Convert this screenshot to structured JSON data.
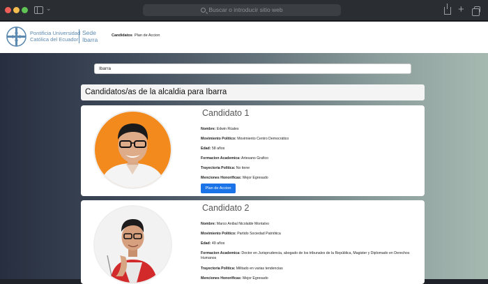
{
  "browser": {
    "url_placeholder": "Buscar o introducir sitio web"
  },
  "header": {
    "logo_line1": "Pontificia Universidad",
    "logo_line2": "Católica del Ecuador",
    "sede_line1": "Sede",
    "sede_line2": "Ibarra",
    "nav": [
      "Candidatos",
      "Plan de Accion"
    ]
  },
  "search": {
    "value": "Ibarra"
  },
  "section_title": "Candidatos/as de la alcaldia para Ibarra",
  "candidates": [
    {
      "title": "Candidato 1",
      "fields": [
        {
          "label": "Nombre:",
          "value": "Edwin Rúales"
        },
        {
          "label": "Movimiento Politico:",
          "value": "Movimiento Centro Democrático"
        },
        {
          "label": "Edad:",
          "value": "58 años"
        },
        {
          "label": "Formacion Academica:",
          "value": "Artesano Grafico"
        },
        {
          "label": "Trayectoria Politica:",
          "value": "No tiene"
        },
        {
          "label": "Menciones Honorificas:",
          "value": "Mejor Egresado"
        }
      ],
      "button": "Plan de Accion"
    },
    {
      "title": "Candidato 2",
      "fields": [
        {
          "label": "Nombre:",
          "value": "Marco Anibal Nicolalde Montalvo"
        },
        {
          "label": "Movimiento Politico:",
          "value": "Partido Sociedad Patriótica"
        },
        {
          "label": "Edad:",
          "value": "49 años"
        },
        {
          "label": "Formacion Academica:",
          "value": "Doctor en Jurisprudencia, abogado de los tribunales de la República, Magister y Diplomado en Derechos Humanos"
        },
        {
          "label": "Trayectoria Politica:",
          "value": "Militado en varias tendencias"
        },
        {
          "label": "Menciones Honorificas:",
          "value": "Mejor Egresado"
        }
      ]
    }
  ],
  "colors": {
    "primary_button": "#1b73e8",
    "logo_blue": "#5d8ab0"
  }
}
